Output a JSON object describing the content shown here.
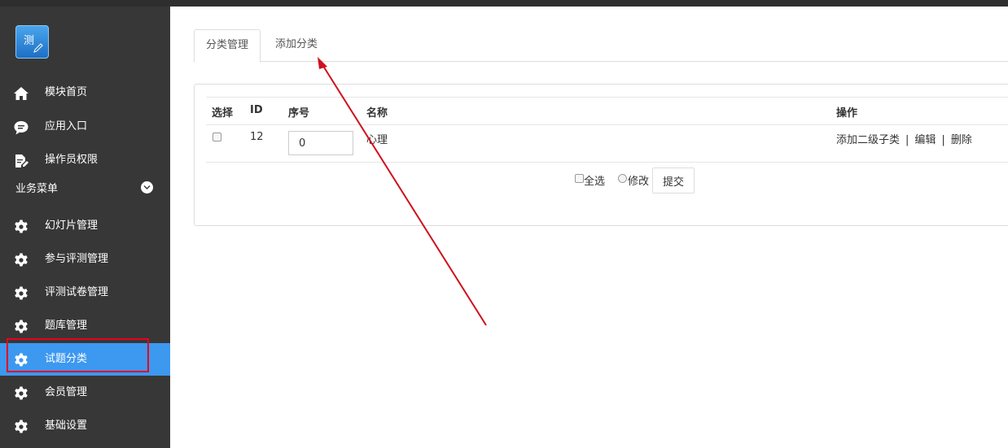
{
  "sidebar": {
    "logo_text": "测",
    "items": [
      {
        "label": "模块首页",
        "icon": "home-icon"
      },
      {
        "label": "应用入口",
        "icon": "chat-bubble-icon"
      },
      {
        "label": "操作员权限",
        "icon": "edit-document-icon"
      }
    ],
    "group_title": "业务菜单",
    "group_items": [
      {
        "label": "幻灯片管理",
        "icon": "gear-icon"
      },
      {
        "label": "参与评测管理",
        "icon": "gear-icon"
      },
      {
        "label": "评测试卷管理",
        "icon": "gear-icon"
      },
      {
        "label": "题库管理",
        "icon": "gear-icon"
      },
      {
        "label": "试题分类",
        "icon": "gear-icon",
        "active": true
      },
      {
        "label": "会员管理",
        "icon": "gear-icon"
      },
      {
        "label": "基础设置",
        "icon": "gear-icon"
      }
    ]
  },
  "tabs": [
    {
      "label": "分类管理",
      "active": true
    },
    {
      "label": "添加分类",
      "active": false
    }
  ],
  "table": {
    "headers": [
      "选择",
      "ID",
      "序号",
      "名称",
      "操作"
    ],
    "rows": [
      {
        "id": "12",
        "seq": "0",
        "name": "心理",
        "actions": [
          "添加二级子类",
          "编辑",
          "删除"
        ]
      }
    ],
    "separator": "|"
  },
  "footer": {
    "select_all": "全选",
    "modify": "修改",
    "submit": "提交"
  },
  "colors": {
    "sidebar_bg": "#373737",
    "active_item": "#3d98f0",
    "annotation_red": "#e8001c"
  }
}
